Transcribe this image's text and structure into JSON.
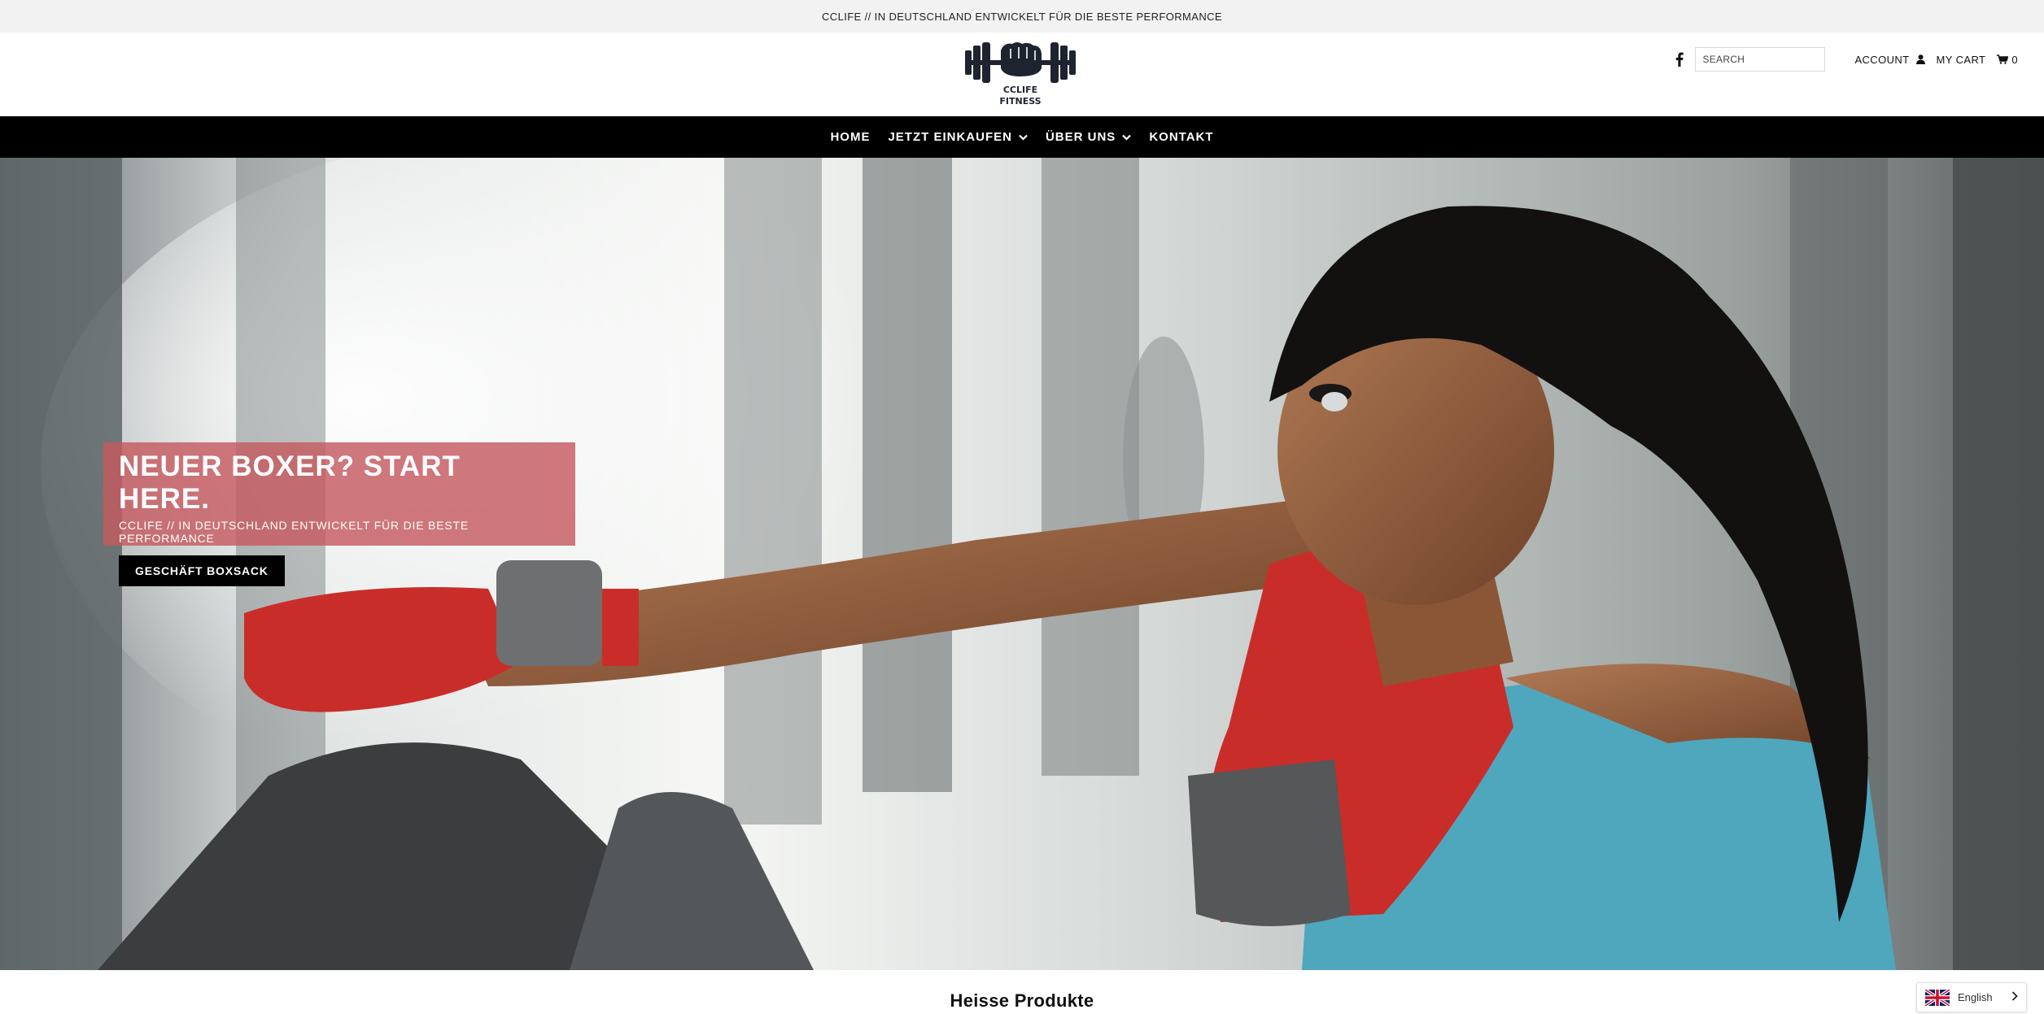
{
  "announcement": "CCLIFE // IN DEUTSCHLAND ENTWICKELT FÜR DIE BESTE PERFORMANCE",
  "logo": {
    "text_top": "CCLIFE",
    "text_bottom": "FITNESS",
    "icon": "dumbbell-fist-logo"
  },
  "header": {
    "facebook_icon": "facebook-icon",
    "search_placeholder": "SEARCH",
    "account_label": "ACCOUNT",
    "account_icon": "user-icon",
    "cart_label": "MY CART",
    "cart_icon": "cart-icon",
    "cart_count": "0"
  },
  "nav": {
    "items": [
      {
        "label": "HOME",
        "dropdown": false
      },
      {
        "label": "JETZT EINKAUFEN",
        "dropdown": true
      },
      {
        "label": "ÜBER UNS",
        "dropdown": true
      },
      {
        "label": "KONTAKT",
        "dropdown": false
      }
    ]
  },
  "hero": {
    "title": "NEUER BOXER? START HERE.",
    "subtitle": "CCLIFE // IN DEUTSCHLAND ENTWICKELT FÜR DIE BESTE PERFORMANCE",
    "button_label": "GESCHÄFT BOXSACK",
    "overlay_color": "#c45a60"
  },
  "section": {
    "title": "Heisse Produkte"
  },
  "language": {
    "label": "English",
    "flag_icon": "uk-flag-icon"
  },
  "colors": {
    "nav_bg": "#000000",
    "announce_bg": "#f2f2f2",
    "glove_red": "#d0312d",
    "top_teal": "#4fa7bd"
  }
}
